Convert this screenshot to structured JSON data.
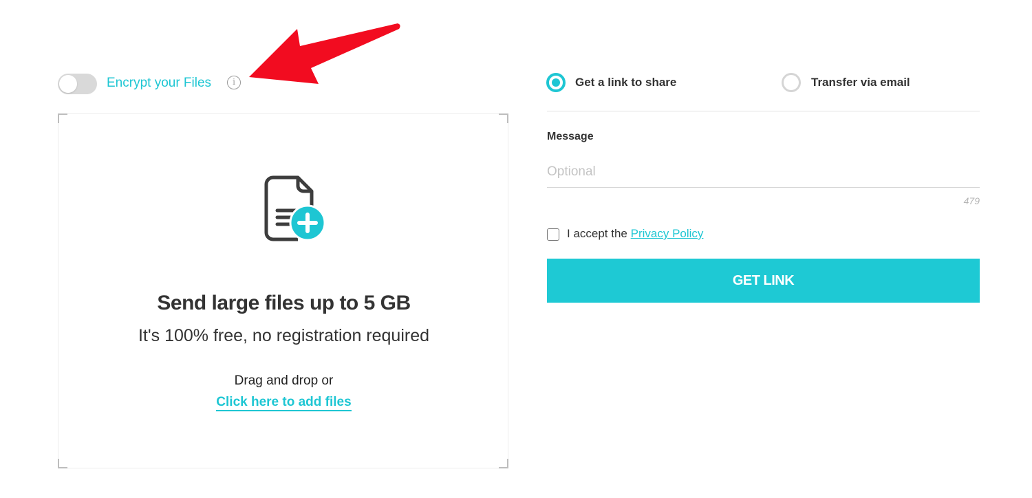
{
  "encrypt": {
    "label": "Encrypt your Files",
    "enabled": false,
    "info_icon": "i"
  },
  "dropzone": {
    "icon": "file-add-icon",
    "title": "Send large files up to 5 GB",
    "subtitle": "It's 100% free, no registration required",
    "drag_text": "Drag and drop or",
    "add_files_link": "Click here to add files"
  },
  "transfer": {
    "options": [
      {
        "label": "Get a link to share",
        "selected": true
      },
      {
        "label": "Transfer via email",
        "selected": false
      }
    ],
    "message": {
      "label": "Message",
      "placeholder": "Optional",
      "value": "",
      "remaining_chars": "479"
    },
    "accept": {
      "prefix": "I accept the ",
      "link": "Privacy Policy",
      "checked": false
    },
    "submit_label": "GET LINK"
  },
  "annotation": {
    "type": "red-arrow",
    "color": "#f20c20",
    "points_to": "encrypt-info-icon"
  },
  "colors": {
    "accent": "#1ec6d3",
    "button": "#1ec9d4",
    "text": "#333333"
  }
}
